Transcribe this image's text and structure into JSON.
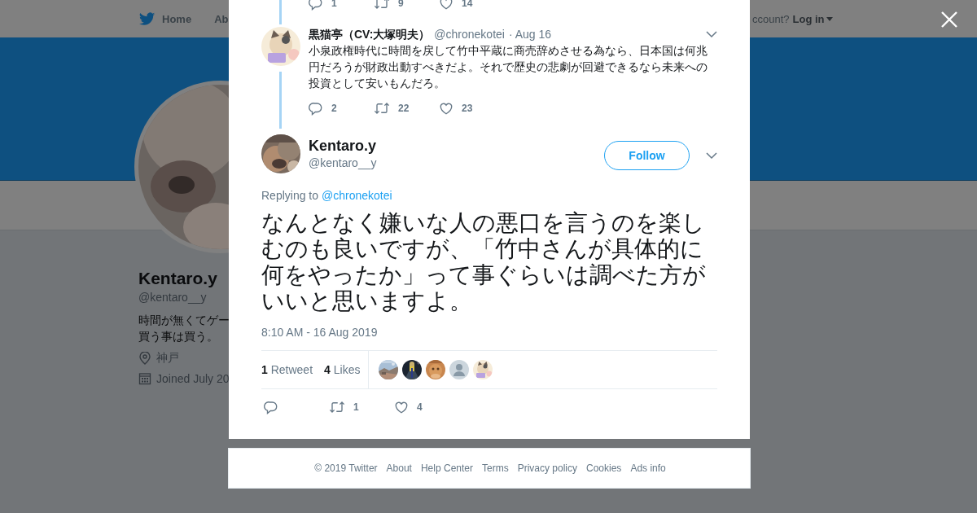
{
  "nav": {
    "home": "Home",
    "about": "Ab",
    "login_prompt": "ccount?",
    "login": "Log in"
  },
  "profile": {
    "name": "Kentaro.y",
    "handle": "@kentaro__y",
    "bio": [
      "時間が無くてゲー",
      "買う事は買う。"
    ],
    "location": "神戸",
    "joined": "Joined July 20"
  },
  "modal": {
    "previous_tweet_actions": {
      "replies": "1",
      "retweets": "9",
      "likes": "14"
    },
    "reply_tweet": {
      "name": "黒猫亭（CV:大塚明夫）",
      "handle": "@chronekotei",
      "date": "· Aug 16",
      "text": "小泉政権時代に時間を戻して竹中平蔵に商売辞めさせる為なら、日本国は何兆円だろうが財政出動すべきだよ。それで歴史の悲劇が回避できるなら未来への投資として安いもんだろ。",
      "replies": "2",
      "retweets": "22",
      "likes": "23"
    },
    "main_tweet": {
      "name": "Kentaro.y",
      "handle": "@kentaro__y",
      "follow": "Follow",
      "replying_label": "Replying to",
      "replying_to": "@chronekotei",
      "text": "なんとなく嫌いな人の悪口を言うのを楽しむのも良いですが、「竹中さんが具体的に何をやったか」って事ぐらいは調べた方がいいと思いますよ。",
      "timestamp": "8:10 AM - 16 Aug 2019",
      "retweet_count": "1",
      "retweet_label": "Retweet",
      "like_count": "4",
      "like_label": "Likes",
      "likers": [
        {
          "kind": "picture"
        },
        {
          "kind": "picture"
        },
        {
          "kind": "picture"
        },
        {
          "kind": "default"
        },
        {
          "kind": "picture"
        }
      ],
      "actions": {
        "retweets": "1",
        "likes": "4"
      }
    }
  },
  "footer": [
    "© 2019 Twitter",
    "About",
    "Help Center",
    "Terms",
    "Privacy policy",
    "Cookies",
    "Ads info"
  ]
}
